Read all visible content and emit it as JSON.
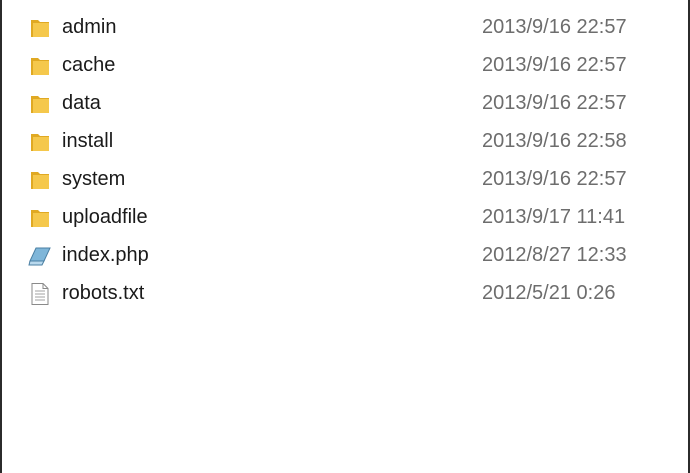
{
  "files": [
    {
      "name": "admin",
      "modified": "2013/9/16 22:57",
      "icon": "folder-icon"
    },
    {
      "name": "cache",
      "modified": "2013/9/16 22:57",
      "icon": "folder-icon"
    },
    {
      "name": "data",
      "modified": "2013/9/16 22:57",
      "icon": "folder-icon"
    },
    {
      "name": "install",
      "modified": "2013/9/16 22:58",
      "icon": "folder-icon"
    },
    {
      "name": "system",
      "modified": "2013/9/16 22:57",
      "icon": "folder-icon"
    },
    {
      "name": "uploadfile",
      "modified": "2013/9/17 11:41",
      "icon": "folder-icon"
    },
    {
      "name": "index.php",
      "modified": "2012/8/27 12:33",
      "icon": "php-file-icon"
    },
    {
      "name": "robots.txt",
      "modified": "2012/5/21 0:26",
      "icon": "text-file-icon"
    }
  ],
  "colors": {
    "folder": "#f5c84c",
    "folder_dark": "#e0a923",
    "php": "#7fb6d9",
    "text": "#1a1a1a",
    "date": "#6d6d6d"
  }
}
